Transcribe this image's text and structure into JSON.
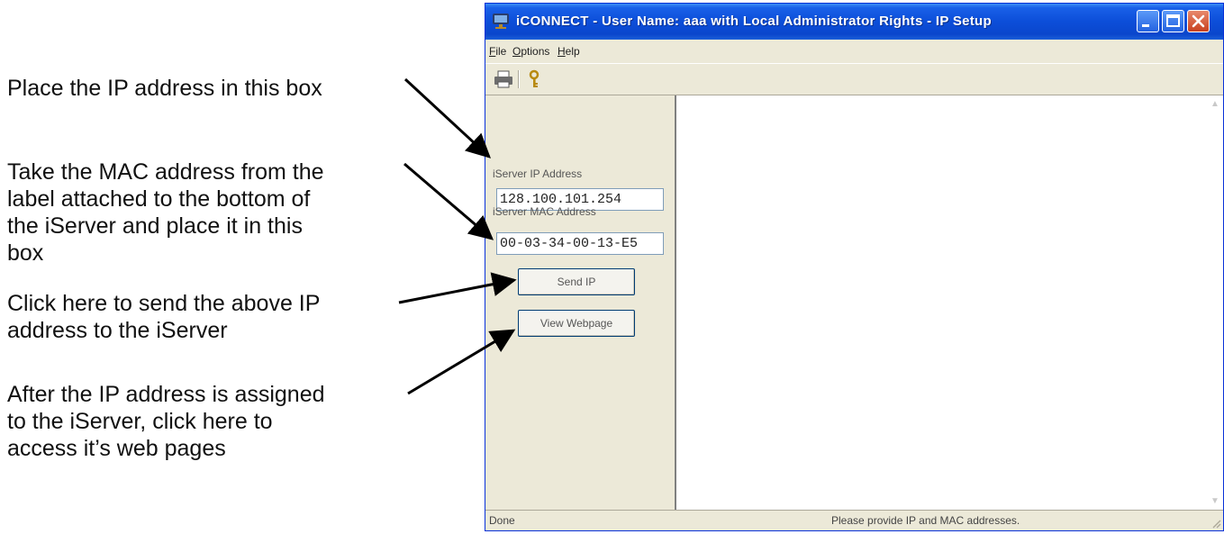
{
  "annotations": {
    "ip_box": "Place the IP address in this box",
    "mac_box": "Take the MAC address from the\nlabel attached to the bottom of\nthe iServer and place it in this\nbox",
    "send_ip": "Click here to send the above IP\naddress to the iServer",
    "view_webpage": "After the IP address is assigned\nto the iServer, click here to\naccess it’s web pages"
  },
  "window": {
    "title": "iCONNECT - User Name: aaa with Local Administrator Rights - IP Setup",
    "title_icon": "network-app-icon",
    "controls": {
      "minimize_icon": "minimize-icon",
      "maximize_icon": "maximize-icon",
      "close_icon": "close-icon"
    }
  },
  "menu": {
    "items": [
      {
        "underline": "F",
        "rest": "ile"
      },
      {
        "underline": "O",
        "rest": "ptions"
      },
      {
        "underline": "H",
        "rest": "elp"
      }
    ]
  },
  "toolbar": {
    "icons": [
      "printer-icon",
      "key-icon"
    ]
  },
  "form": {
    "ip_label": "iServer IP Address",
    "ip_value": "128.100.101.254",
    "mac_label": "iServer MAC Address",
    "mac_value": "00-03-34-00-13-E5",
    "send_ip_label": "Send IP",
    "view_webpage_label": "View Webpage"
  },
  "status": {
    "left": "Done",
    "right": "Please provide IP and MAC addresses."
  },
  "colors": {
    "titlebar": "#0a46cc",
    "window_bg": "#ece9d8",
    "close_button": "#c8401e"
  }
}
